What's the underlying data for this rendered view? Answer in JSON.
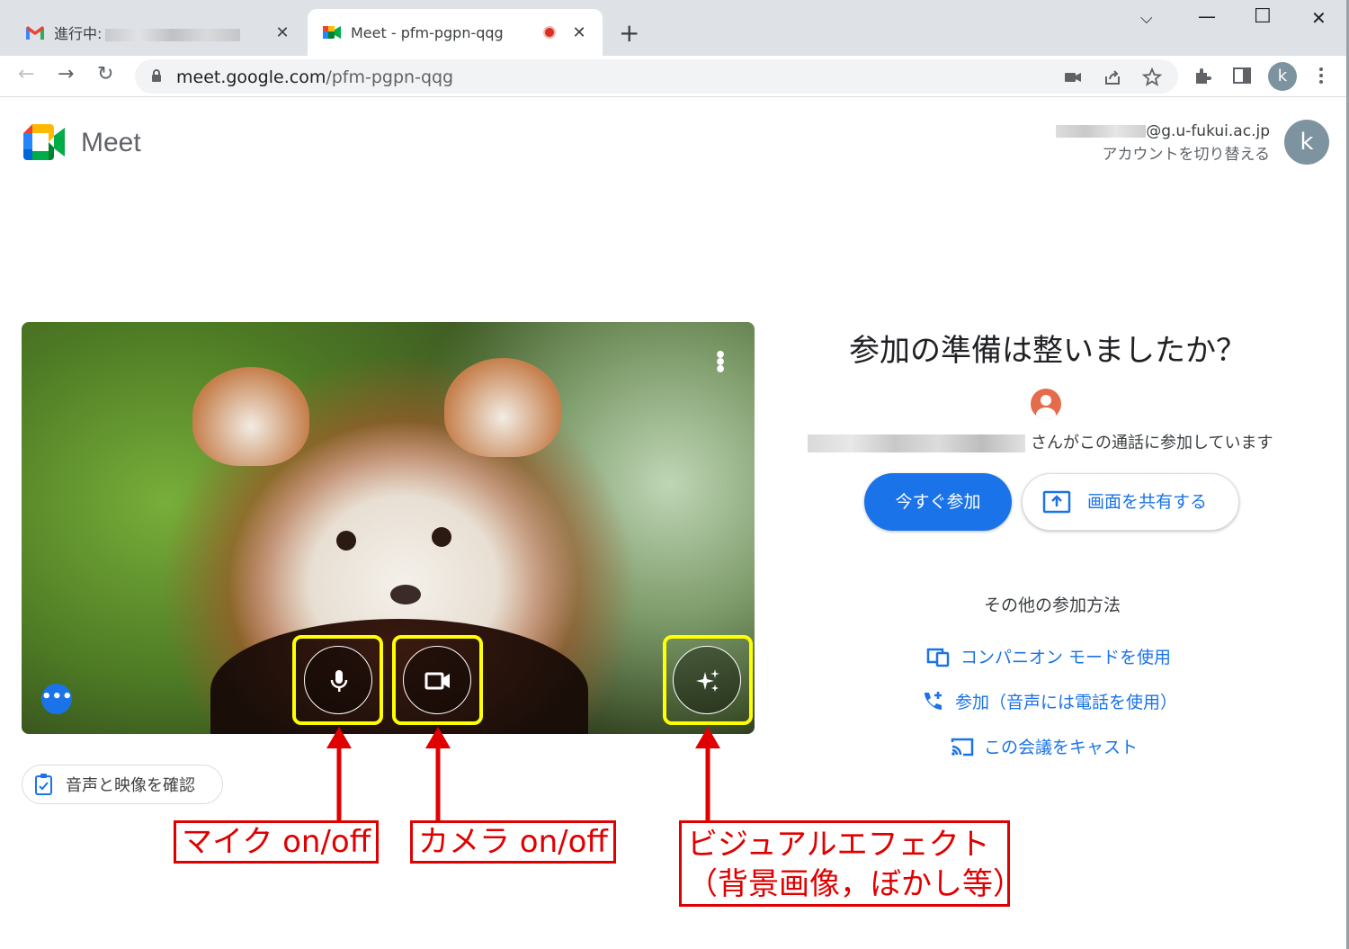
{
  "browser": {
    "tabs": [
      {
        "title_prefix": "進行中:",
        "close": "✕"
      },
      {
        "title": "Meet - pfm-pgpn-qqg",
        "close": "✕"
      }
    ],
    "new_tab": "+",
    "window_controls": {
      "dropdown": "⌵",
      "minimize": "—",
      "maximize": "☐",
      "close": "✕"
    },
    "nav": {
      "back": "←",
      "forward": "→",
      "reload": "↻"
    },
    "url_domain": "meet.google.com",
    "url_path": "/pfm-pgpn-qqg",
    "profile_initial": "k"
  },
  "header": {
    "product_name": "Meet",
    "account_email_suffix": "@g.u-fukui.ac.jp",
    "switch_account": "アカウントを切り替える",
    "avatar_initial": "k"
  },
  "preview": {
    "menu_dots": "⋮",
    "more_options": "•••"
  },
  "check_av_label": "音声と映像を確認",
  "join_panel": {
    "title": "参加の準備は整いましたか？",
    "in_call_text": "さんがこの通話に参加しています",
    "join_now": "今すぐ参加",
    "share_screen": "画面を共有する",
    "other_ways_title": "その他の参加方法",
    "companion_mode": "コンパニオン モードを使用",
    "join_phone_audio": "参加（音声には電話を使用）",
    "cast_meeting": "この会議をキャスト"
  },
  "annotations": {
    "mic": "マイク on/off",
    "camera": "カメラ on/off",
    "effects_line1": "ビジュアルエフェクト",
    "effects_line2": "（背景画像，ぼかし等）"
  },
  "colors": {
    "accent": "#1a73e8",
    "annotation_red": "#e00000",
    "highlight_yellow": "#ffff00"
  }
}
